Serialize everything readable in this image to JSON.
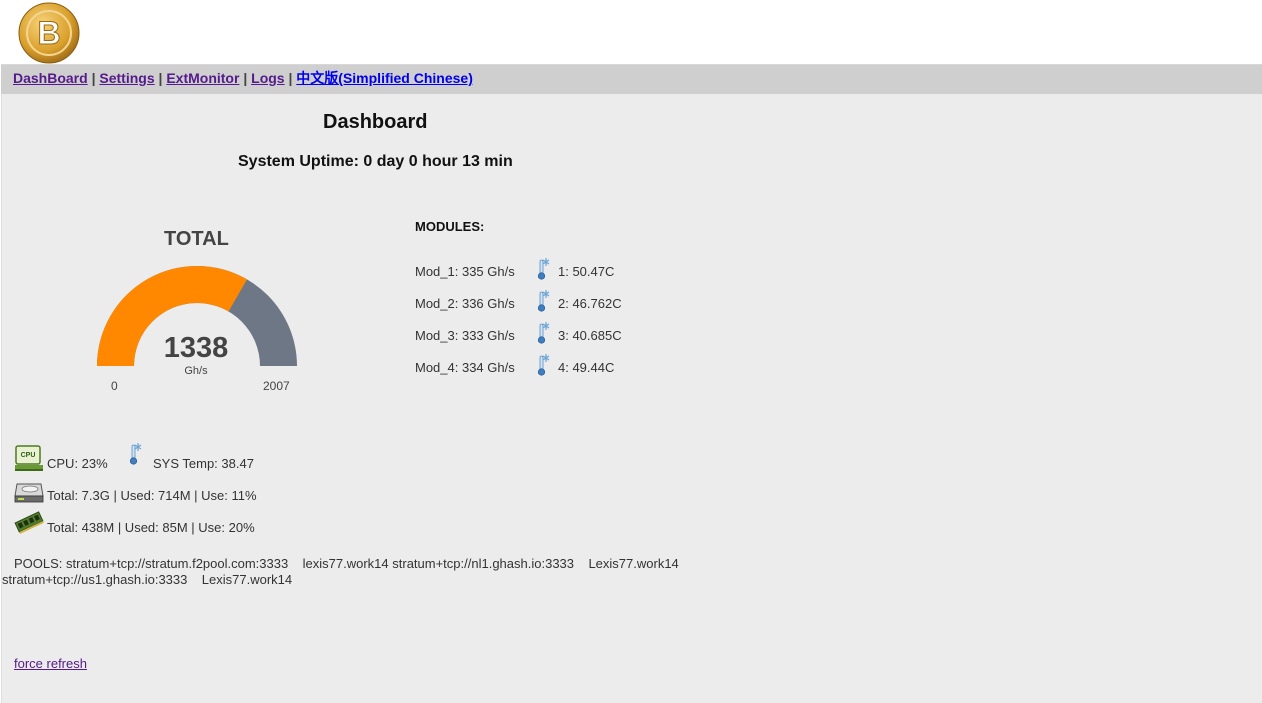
{
  "logo": {
    "icon": "bitcoin-logo-icon",
    "symbol": "B"
  },
  "nav": {
    "items": [
      {
        "label": "DashBoard"
      },
      {
        "label": "Settings"
      },
      {
        "label": "ExtMonitor"
      },
      {
        "label": "Logs"
      },
      {
        "label": "中文版(Simplified Chinese)"
      }
    ],
    "separator": "|"
  },
  "dashboard": {
    "title": "Dashboard",
    "uptime": "System Uptime: 0 day 0 hour 13 min"
  },
  "gauge": {
    "title": "TOTAL",
    "value": 1338,
    "value_text": "1338",
    "unit": "Gh/s",
    "min": 0,
    "min_text": "0",
    "max": 2007,
    "max_text": "2007",
    "fill_color": "#ff8800",
    "track_color": "#6d7785"
  },
  "modules": {
    "title": "MODULES:",
    "items": [
      {
        "rate": "Mod_1: 335 Gh/s",
        "temp": "1: 50.47C"
      },
      {
        "rate": "Mod_2: 336 Gh/s",
        "temp": "2: 46.762C"
      },
      {
        "rate": "Mod_3: 333 Gh/s",
        "temp": "3: 40.685C"
      },
      {
        "rate": "Mod_4: 334 Gh/s",
        "temp": "4: 49.44C"
      }
    ]
  },
  "system": {
    "cpu": "CPU: 23%",
    "sys_temp": "SYS Temp: 38.47",
    "disk": "Total: 7.3G | Used: 714M | Use: 11%",
    "memory": "Total: 438M | Used: 85M | Use: 20%"
  },
  "pools": {
    "text": "POOLS: stratum+tcp://stratum.f2pool.com:3333    lexis77.work14 stratum+tcp://nl1.ghash.io:3333    Lexis77.work14 stratum+tcp://us1.ghash.io:3333    Lexis77.work14"
  },
  "force_refresh": "force refresh "
}
